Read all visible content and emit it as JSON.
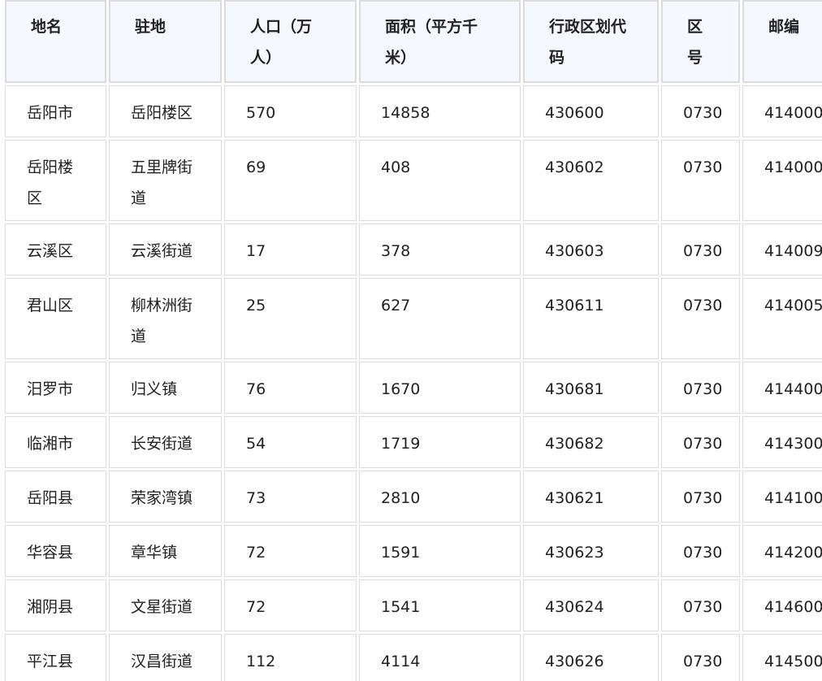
{
  "table": {
    "headers": [
      "地名",
      "驻地",
      "人口（万人）",
      "面积（平方千米）",
      "行政区划代码",
      "区号",
      "邮编"
    ],
    "rows": [
      [
        "岳阳市",
        "岳阳楼区",
        "570",
        "14858",
        "430600",
        "0730",
        "414000"
      ],
      [
        "岳阳楼区",
        "五里牌街道",
        "69",
        "408",
        "430602",
        "0730",
        "414000"
      ],
      [
        "云溪区",
        "云溪街道",
        "17",
        "378",
        "430603",
        "0730",
        "414009"
      ],
      [
        "君山区",
        "柳林洲街道",
        "25",
        "627",
        "430611",
        "0730",
        "414005"
      ],
      [
        "汨罗市",
        "归义镇",
        "76",
        "1670",
        "430681",
        "0730",
        "414400"
      ],
      [
        "临湘市",
        "长安街道",
        "54",
        "1719",
        "430682",
        "0730",
        "414300"
      ],
      [
        "岳阳县",
        "荣家湾镇",
        "73",
        "2810",
        "430621",
        "0730",
        "414100"
      ],
      [
        "华容县",
        "章华镇",
        "72",
        "1591",
        "430623",
        "0730",
        "414200"
      ],
      [
        "湘阴县",
        "文星街道",
        "72",
        "1541",
        "430624",
        "0730",
        "414600"
      ],
      [
        "平江县",
        "汉昌街道",
        "112",
        "4114",
        "430626",
        "0730",
        "414500"
      ]
    ]
  }
}
